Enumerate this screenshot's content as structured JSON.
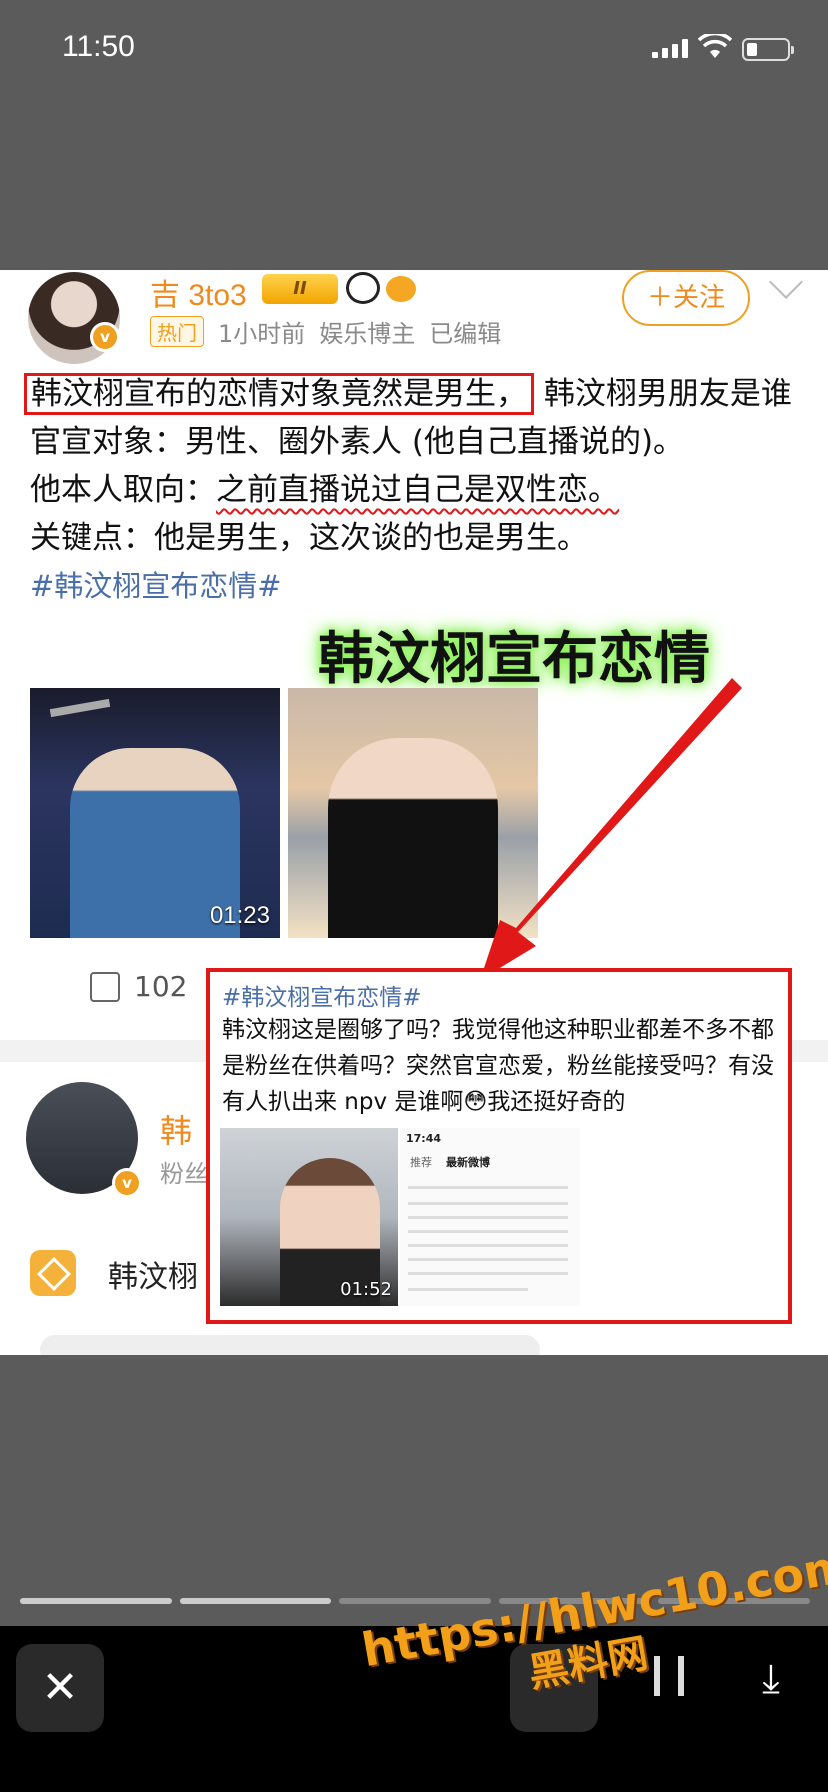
{
  "status_bar": {
    "time": "11:50"
  },
  "post": {
    "username": "吉 3to3",
    "crown_level": "II",
    "tag": "热门",
    "time": "1小时前",
    "role": "娱乐博主",
    "edited": "已编辑",
    "follow_label": "＋关注",
    "line1_highlight": "韩汶栩宣布的恋情对象竟然是男生，",
    "line1_rest": "韩汶栩男朋友是谁",
    "line2": "官宣对象：男性、圈外素人 (他自己直播说的)。",
    "line3_prefix": "他本人取向：",
    "line3_underlined": "之前直播说过自己是双性恋。",
    "line4": "关键点：他是男生，这次谈的也是男生。",
    "hashtag": "#韩汶栩宣布恋情#",
    "big_title": "韩汶栩宣布恋情",
    "video1_duration": "01:23",
    "share_count": "102"
  },
  "second_post": {
    "username_partial": "韩",
    "sub_partial": "粉丝",
    "topic": "韩汶栩"
  },
  "overlay": {
    "hashtag": "#韩汶栩宣布恋情#",
    "text": "韩汶栩这是圈够了吗？我觉得他这种职业都差不多不都是粉丝在供着吗？突然官宣恋爱，粉丝能接受吗？有没有人扒出来 npv 是谁啊😳我还挺好奇的",
    "video_duration": "01:52",
    "shot_time": "17:44",
    "shot_tab1": "推荐",
    "shot_tab2": "最新微博"
  },
  "viewer": {
    "close_label": "✕",
    "download_label": "⤓",
    "progress_total": 5,
    "progress_current": 2
  },
  "watermark": {
    "line1": "https://hlwc10.com",
    "line2": "黑料网"
  },
  "colors": {
    "accent_orange": "#f08a1c",
    "highlight_red": "#e01818",
    "hashtag_blue": "#4a6ea8",
    "glow_green": "#8ef25a"
  }
}
